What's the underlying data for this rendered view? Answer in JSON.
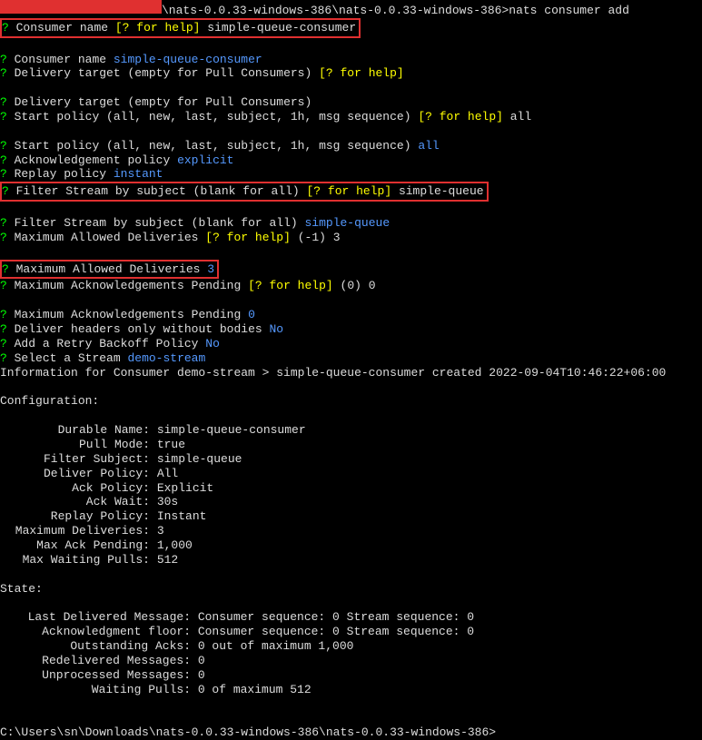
{
  "prompt_path_suffix": "\\nats-0.0.33-windows-386\\nats-0.0.33-windows-386>",
  "command": "nats consumer add",
  "q": "?",
  "help_hint": "[? for help]",
  "labels": {
    "consumer_name": "Consumer name",
    "delivery_target": "Delivery target (empty for Pull Consumers)",
    "start_policy": "Start policy (all, new, last, subject, 1h, msg sequence)",
    "ack_policy": "Acknowledgement policy",
    "replay_policy": "Replay policy",
    "filter_stream": "Filter Stream by subject (blank for all)",
    "max_deliveries": "Maximum Allowed Deliveries",
    "max_ack_pending": "Maximum Acknowledgements Pending",
    "deliver_headers": "Deliver headers only without bodies",
    "retry_backoff": "Add a Retry Backoff Policy",
    "select_stream": "Select a Stream"
  },
  "values": {
    "consumer_name_white": "simple-queue-consumer",
    "consumer_name_blue": "simple-queue-consumer",
    "start_all_white": "all",
    "start_all_blue": "all",
    "explicit": "explicit",
    "instant": "instant",
    "filter_white": "simple-queue",
    "filter_blue": "simple-queue",
    "max_deliv_suffix": "(-1) 3",
    "max_deliv_blue": "3",
    "max_ack_suffix": "(0) 0",
    "zero_blue": "0",
    "no": "No",
    "no2": "No",
    "demo_stream": "demo-stream"
  },
  "info_line_prefix": "Information for Consumer demo-stream > simple-queue-consumer created ",
  "info_timestamp": "2022-09-04T10:46:22+06:00",
  "config_header": "Configuration:",
  "config": {
    "durable_name_l": "Durable Name:",
    "durable_name_v": "simple-queue-consumer",
    "pull_mode_l": "Pull Mode:",
    "pull_mode_v": "true",
    "filter_subject_l": "Filter Subject:",
    "filter_subject_v": "simple-queue",
    "deliver_policy_l": "Deliver Policy:",
    "deliver_policy_v": "All",
    "ack_policy_l": "Ack Policy:",
    "ack_policy_v": "Explicit",
    "ack_wait_l": "Ack Wait:",
    "ack_wait_v": "30s",
    "replay_policy_l": "Replay Policy:",
    "replay_policy_v": "Instant",
    "max_deliveries_l": "Maximum Deliveries:",
    "max_deliveries_v": "3",
    "max_ack_pending_l": "Max Ack Pending:",
    "max_ack_pending_v": "1,000",
    "max_waiting_l": "Max Waiting Pulls:",
    "max_waiting_v": "512"
  },
  "state_header": "State:",
  "state": {
    "last_delivered_l": "Last Delivered Message:",
    "last_delivered_v": "Consumer sequence: 0 Stream sequence: 0",
    "ack_floor_l": "Acknowledgment floor:",
    "ack_floor_v": "Consumer sequence: 0 Stream sequence: 0",
    "outstanding_l": "Outstanding Acks:",
    "outstanding_v": "0 out of maximum 1,000",
    "redelivered_l": "Redelivered Messages:",
    "redelivered_v": "0",
    "unprocessed_l": "Unprocessed Messages:",
    "unprocessed_v": "0",
    "waiting_pulls_l": "Waiting Pulls:",
    "waiting_pulls_v": "0 of maximum 512"
  },
  "footer_path": "C:\\Users\\sn\\Downloads\\nats-0.0.33-windows-386\\nats-0.0.33-windows-386>"
}
